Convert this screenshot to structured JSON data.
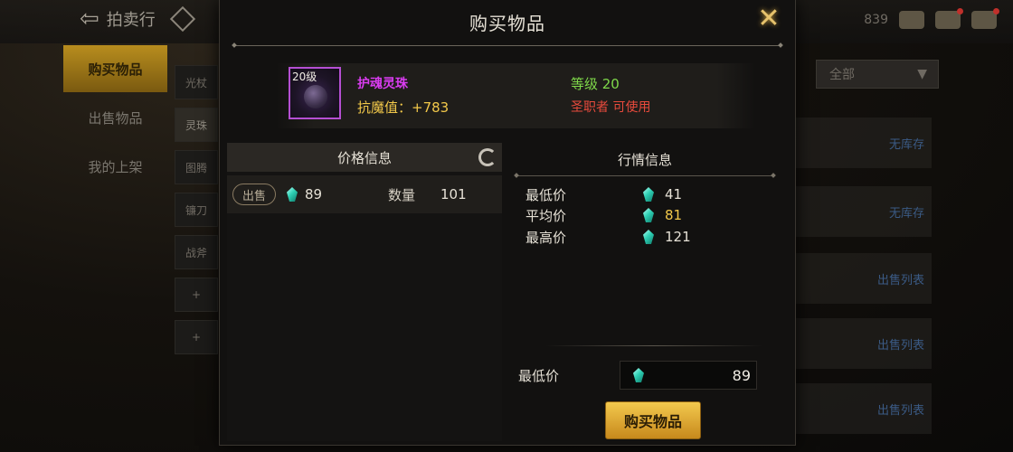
{
  "background": {
    "back_label": "拍卖行",
    "left_nav": [
      {
        "label": "购买物品",
        "active": true
      },
      {
        "label": "出售物品",
        "active": false
      },
      {
        "label": "我的上架",
        "active": false
      }
    ],
    "sub_tabs": [
      {
        "label": "光杖"
      },
      {
        "label": "灵珠"
      },
      {
        "label": "图腾"
      },
      {
        "label": "镰刀"
      },
      {
        "label": "战斧"
      },
      {
        "label": "+"
      },
      {
        "label": "+"
      }
    ],
    "filter_label": "全部",
    "currency_fragment": "839",
    "right_rows": [
      {
        "label": "无库存"
      },
      {
        "label": "无库存"
      },
      {
        "label": "出售列表"
      },
      {
        "label": "出售列表"
      },
      {
        "label": "出售列表"
      }
    ]
  },
  "modal": {
    "title": "购买物品",
    "item": {
      "level_badge": "20级",
      "name": "护魂灵珠",
      "stat": "抗魔值：+783",
      "level": "等级 20",
      "class_requirement": "圣职者 可使用"
    },
    "price_panel": {
      "header": "价格信息",
      "sell_badge": "出售",
      "price": "89",
      "quantity_label": "数量",
      "quantity": "101"
    },
    "market_panel": {
      "header": "行情信息",
      "rows": [
        {
          "label": "最低价",
          "value": "41"
        },
        {
          "label": "平均价",
          "value": "81"
        },
        {
          "label": "最高价",
          "value": "121"
        }
      ],
      "min_label": "最低价",
      "min_value": "89",
      "buy_button": "购买物品"
    }
  },
  "colors": {
    "accent_gold": "#f2c84a",
    "item_name": "#d93cf0",
    "level_green": "#7fd94a",
    "class_red": "#e84a3c",
    "gem_teal": "#2fd1b5"
  }
}
